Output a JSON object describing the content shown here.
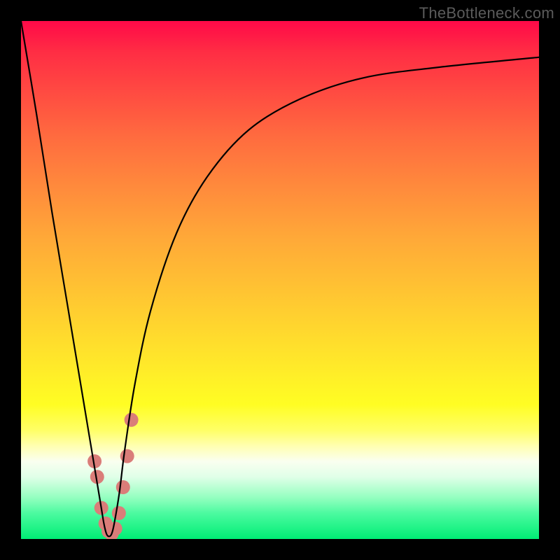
{
  "watermark": "TheBottleneck.com",
  "chart_data": {
    "type": "line",
    "title": "",
    "xlabel": "",
    "ylabel": "",
    "xlim": [
      0,
      100
    ],
    "ylim": [
      0,
      100
    ],
    "grid": false,
    "series": [
      {
        "name": "bottleneck-curve",
        "x": [
          0,
          3,
          6,
          9,
          12,
          14,
          15.5,
          16,
          16.5,
          17,
          17.5,
          18,
          19,
          20,
          22,
          25,
          30,
          36,
          44,
          54,
          66,
          80,
          100
        ],
        "values": [
          100,
          82,
          63,
          45,
          27,
          15,
          6,
          3,
          1,
          0.5,
          1,
          3,
          9,
          17,
          30,
          44,
          59,
          70,
          79,
          85,
          89,
          91,
          93
        ],
        "color": "#000000"
      },
      {
        "name": "marker-dots",
        "type": "scatter",
        "x": [
          14.2,
          14.7,
          15.5,
          16.3,
          16.9,
          17.5,
          18.2,
          18.9,
          19.7,
          20.5,
          21.3
        ],
        "values": [
          15,
          12,
          6,
          3,
          1.5,
          1,
          2,
          5,
          10,
          16,
          23
        ],
        "color": "#da7d79",
        "marker_radius": 10
      }
    ],
    "background_gradient_stops": [
      {
        "pos": 0,
        "color": "#ff0948"
      },
      {
        "pos": 6,
        "color": "#ff2d44"
      },
      {
        "pos": 22,
        "color": "#ff6a3f"
      },
      {
        "pos": 32,
        "color": "#ff8a3c"
      },
      {
        "pos": 42,
        "color": "#ffa938"
      },
      {
        "pos": 56,
        "color": "#ffce30"
      },
      {
        "pos": 66,
        "color": "#ffe82a"
      },
      {
        "pos": 74,
        "color": "#fffd23"
      },
      {
        "pos": 79,
        "color": "#ffff66"
      },
      {
        "pos": 82,
        "color": "#ffffb0"
      },
      {
        "pos": 85,
        "color": "#fafff0"
      },
      {
        "pos": 88,
        "color": "#e0ffe8"
      },
      {
        "pos": 92,
        "color": "#94ffc0"
      },
      {
        "pos": 95,
        "color": "#4cfaa0"
      },
      {
        "pos": 100,
        "color": "#00ee75"
      }
    ]
  }
}
